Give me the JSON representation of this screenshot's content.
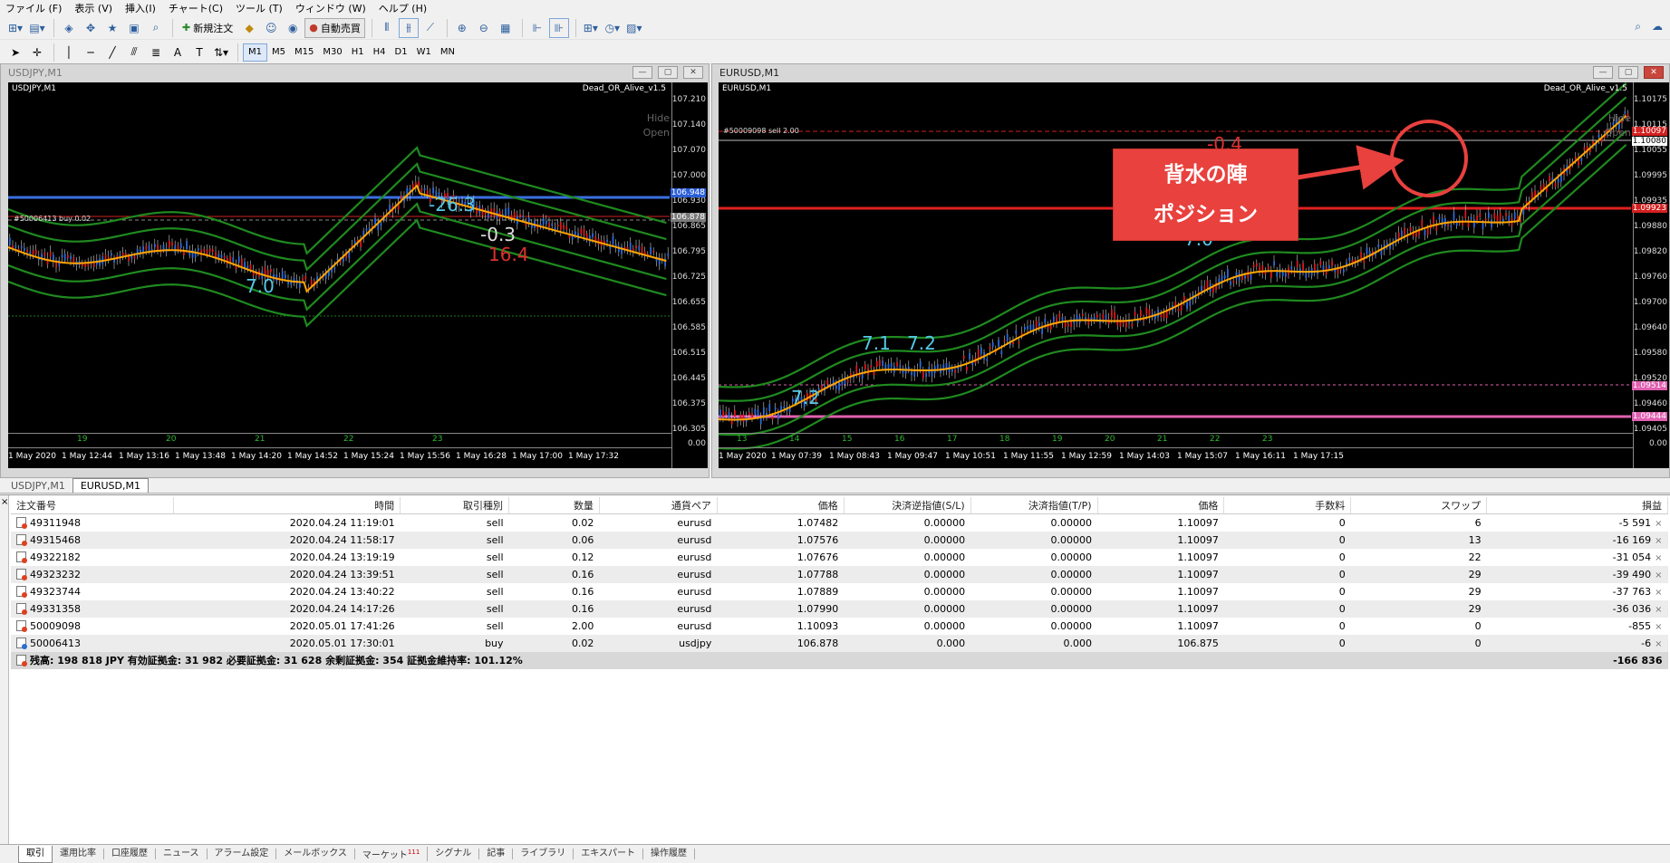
{
  "menu": [
    "ファイル (F)",
    "表示 (V)",
    "挿入(I)",
    "チャート(C)",
    "ツール (T)",
    "ウィンドウ (W)",
    "ヘルプ (H)"
  ],
  "toolbar": {
    "new_order": "新規注文",
    "auto_trade": "自動売買",
    "timeframes": [
      "M1",
      "M5",
      "M15",
      "M30",
      "H1",
      "H4",
      "D1",
      "W1",
      "MN"
    ],
    "active_timeframe": "M1"
  },
  "left_window": {
    "title": "USDJPY,M1",
    "chart_label": "USDJPY,M1",
    "indicator": "Dead_OR_Alive_v1.5",
    "hide_label": "Hide",
    "open_label": "Open",
    "position_label": "#50006413 buy 0.02",
    "price_labels": [
      "107.210",
      "107.140",
      "107.070",
      "107.000",
      "106.930",
      "106.865",
      "106.795",
      "106.725",
      "106.655",
      "106.585",
      "106.515",
      "106.445",
      "106.375",
      "106.305",
      "0.00"
    ],
    "highlight_blue": "106.948",
    "highlight_gray": "106.878",
    "time_labels": [
      "1 May 2020",
      "1 May 12:44",
      "1 May 13:16",
      "1 May 13:48",
      "1 May 14:20",
      "1 May 14:52",
      "1 May 15:24",
      "1 May 15:56",
      "1 May 16:28",
      "1 May 17:00",
      "1 May 17:32"
    ],
    "hour_labels": [
      "19",
      "20",
      "21",
      "22",
      "23"
    ],
    "chart_text": {
      "t1": "7.0",
      "t2": "-0.3",
      "t3": "-26.3",
      "t4": "16.4"
    }
  },
  "right_window": {
    "title": "EURUSD,M1",
    "chart_label": "EURUSD,M1",
    "indicator": "Dead_OR_Alive_v1.5",
    "hide_label": "Hide",
    "open_label": "Open",
    "position_label": "#50009098 sell 2.00",
    "price_labels": [
      "1.10175",
      "1.10115",
      "1.10055",
      "1.09995",
      "1.09935",
      "1.09880",
      "1.09820",
      "1.09760",
      "1.09700",
      "1.09640",
      "1.09580",
      "1.09520",
      "1.09460",
      "1.09405",
      "0.00"
    ],
    "highlight_red_top": "1.10097",
    "highlight_box": "1.10080",
    "highlight_red_mid": "1.09923",
    "highlight_pink1": "1.09514",
    "highlight_pink2": "1.09444",
    "time_labels": [
      "1 May 2020",
      "1 May 07:39",
      "1 May 08:43",
      "1 May 09:47",
      "1 May 10:51",
      "1 May 11:55",
      "1 May 12:59",
      "1 May 14:03",
      "1 May 15:07",
      "1 May 16:11",
      "1 May 17:15"
    ],
    "hour_labels": [
      "13",
      "14",
      "15",
      "16",
      "17",
      "18",
      "19",
      "20",
      "21",
      "22",
      "23"
    ],
    "chart_text": {
      "t1": "7.2",
      "t2": "7.1",
      "t3": "7.2",
      "t4": "7.0",
      "t5": "-0.4"
    },
    "callout_line1": "背水の陣",
    "callout_line2": "ポジション"
  },
  "chart_tabs": [
    "USDJPY,M1",
    "EURUSD,M1"
  ],
  "active_chart_tab": "EURUSD,M1",
  "terminal": {
    "columns": [
      "注文番号",
      "時間",
      "取引種別",
      "数量",
      "通貨ペア",
      "価格",
      "決済逆指値(S/L)",
      "決済指値(T/P)",
      "価格",
      "手数料",
      "スワップ",
      "損益"
    ],
    "rows": [
      [
        "49311948",
        "2020.04.24 11:19:01",
        "sell",
        "0.02",
        "eurusd",
        "1.07482",
        "0.00000",
        "0.00000",
        "1.10097",
        "0",
        "6",
        "-5 591"
      ],
      [
        "49315468",
        "2020.04.24 11:58:17",
        "sell",
        "0.06",
        "eurusd",
        "1.07576",
        "0.00000",
        "0.00000",
        "1.10097",
        "0",
        "13",
        "-16 169"
      ],
      [
        "49322182",
        "2020.04.24 13:19:19",
        "sell",
        "0.12",
        "eurusd",
        "1.07676",
        "0.00000",
        "0.00000",
        "1.10097",
        "0",
        "22",
        "-31 054"
      ],
      [
        "49323232",
        "2020.04.24 13:39:51",
        "sell",
        "0.16",
        "eurusd",
        "1.07788",
        "0.00000",
        "0.00000",
        "1.10097",
        "0",
        "29",
        "-39 490"
      ],
      [
        "49323744",
        "2020.04.24 13:40:22",
        "sell",
        "0.16",
        "eurusd",
        "1.07889",
        "0.00000",
        "0.00000",
        "1.10097",
        "0",
        "29",
        "-37 763"
      ],
      [
        "49331358",
        "2020.04.24 14:17:26",
        "sell",
        "0.16",
        "eurusd",
        "1.07990",
        "0.00000",
        "0.00000",
        "1.10097",
        "0",
        "29",
        "-36 036"
      ],
      [
        "50009098",
        "2020.05.01 17:41:26",
        "sell",
        "2.00",
        "eurusd",
        "1.10093",
        "0.00000",
        "0.00000",
        "1.10097",
        "0",
        "0",
        "-855"
      ],
      [
        "50006413",
        "2020.05.01 17:30:01",
        "buy",
        "0.02",
        "usdjpy",
        "106.878",
        "0.000",
        "0.000",
        "106.875",
        "0",
        "0",
        "-6"
      ]
    ],
    "summary": "残高: 198 818 JPY  有効証拠金: 31 982  必要証拠金: 31 628  余剰証拠金: 354  証拠金維持率: 101.12%",
    "summary_total": "-166 836"
  },
  "bottom_tabs": [
    "取引",
    "運用比率",
    "口座履歴",
    "ニュース",
    "アラーム設定",
    "メールボックス",
    "マーケット",
    "シグナル",
    "記事",
    "ライブラリ",
    "エキスパート",
    "操作履歴"
  ],
  "market_badge": "111",
  "colors": {
    "candle_up": "#2a6ad8",
    "candle_down": "#d81a1a",
    "ma": "#ffa500",
    "band": "#1f8a1f",
    "callout": "#e8413e"
  }
}
